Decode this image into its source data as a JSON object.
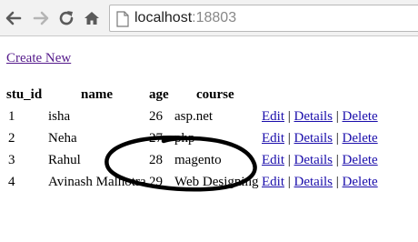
{
  "browser": {
    "url_host": "localhost",
    "url_port": ":18803",
    "icons": {
      "back": "back-arrow-icon",
      "forward": "forward-arrow-icon",
      "reload": "reload-icon",
      "home": "home-icon",
      "page": "page-icon"
    }
  },
  "page": {
    "create_new": "Create New",
    "headers": {
      "stu_id": "stu_id",
      "name": "name",
      "age": "age",
      "course": "course"
    },
    "rows": [
      {
        "stu_id": "1",
        "name": "isha",
        "age": "26",
        "course": "asp.net"
      },
      {
        "stu_id": "2",
        "name": "Neha",
        "age": "27",
        "course": "php"
      },
      {
        "stu_id": "3",
        "name": "Rahul",
        "age": "28",
        "course": "magento"
      },
      {
        "stu_id": "4",
        "name": "Avinash Malhotra",
        "age": "29",
        "course": "Web Designing"
      }
    ],
    "actions": {
      "edit": "Edit",
      "details": "Details",
      "delete": "Delete",
      "separator": "|"
    }
  },
  "colors": {
    "link": "#1a0dab",
    "visited_link": "#551a8b",
    "annotation": "#000000"
  }
}
